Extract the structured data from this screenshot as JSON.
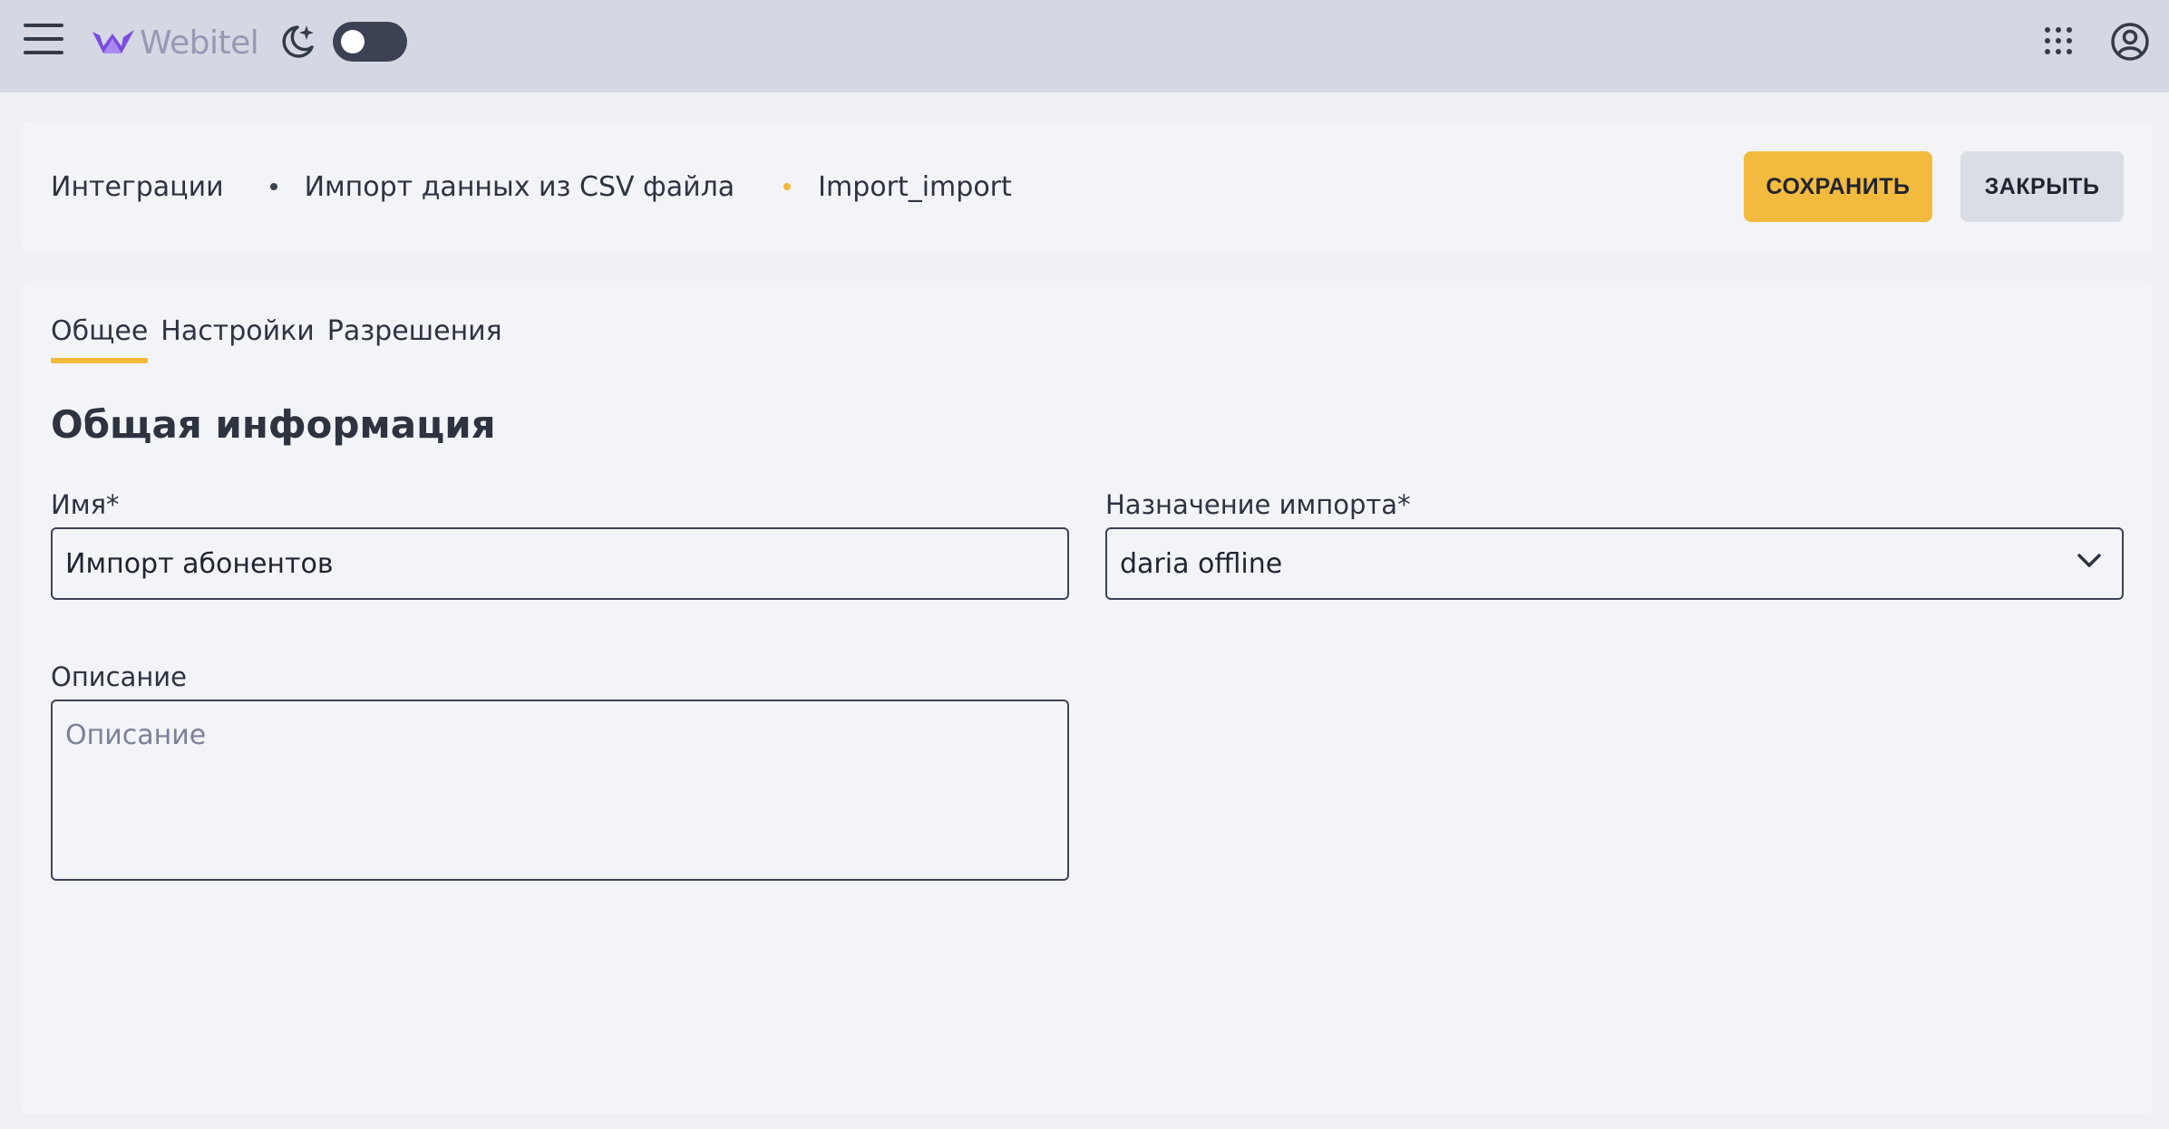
{
  "app": {
    "logo_text": "Webitel",
    "theme_toggle": "off"
  },
  "breadcrumb": {
    "items": [
      "Интеграции",
      "Импорт данных из CSV файла",
      "Import_import"
    ]
  },
  "actions": {
    "save_label": "СОХРАНИТЬ",
    "close_label": "ЗАКРЫТЬ"
  },
  "tabs": [
    {
      "label": "Общее",
      "active": true
    },
    {
      "label": "Настройки",
      "active": false
    },
    {
      "label": "Разрешения",
      "active": false
    }
  ],
  "form": {
    "section_title": "Общая информация",
    "name": {
      "label": "Имя*",
      "value": "Импорт абонентов"
    },
    "destination": {
      "label": "Назначение импорта*",
      "value": "daria offline"
    },
    "description": {
      "label": "Описание",
      "placeholder": "Описание",
      "value": ""
    }
  },
  "colors": {
    "accent": "#f2b83a",
    "topbar": "#d5d8e3",
    "background": "#eff0f3",
    "card": "#f3f4f7",
    "text": "#2e3340"
  }
}
